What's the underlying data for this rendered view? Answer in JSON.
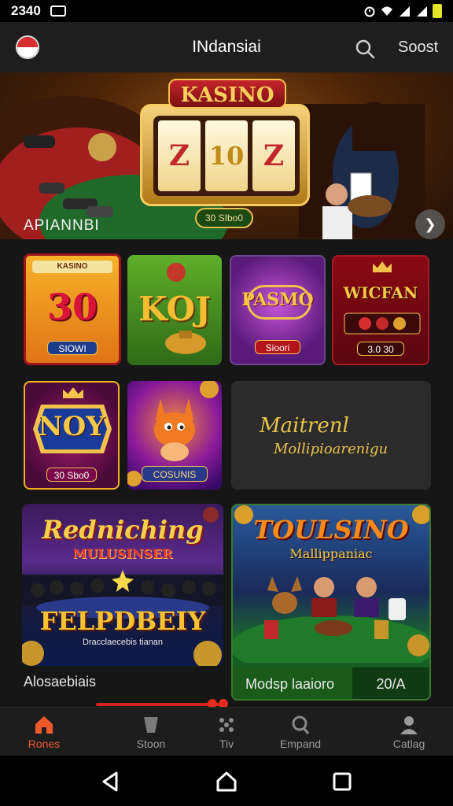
{
  "status": {
    "time": "2340"
  },
  "header": {
    "title": "INdansiai",
    "action_label": "Soost"
  },
  "banner": {
    "title": "KASINO",
    "reels": [
      "Z",
      "10",
      "Z"
    ],
    "button": "30 SIbo0",
    "caption": "APIANNBI"
  },
  "tiles": {
    "t1": {
      "label_top": "KASINO",
      "title": "30",
      "pill": "SIOWI"
    },
    "t2": {
      "title": "KOJ"
    },
    "t3": {
      "title": "PASMO",
      "pill": "Sioori"
    },
    "t4": {
      "title": "WICFAN",
      "pill": "3.0 30"
    },
    "t5": {
      "title": "NOY",
      "pill": "30 Sbo0"
    },
    "t6": {
      "pill": "COSUNIS"
    },
    "t7": {
      "line1": "Maitrenl",
      "line2": "Mollipioarenigu"
    }
  },
  "promos": {
    "left": {
      "headline": "Redniching",
      "sub": "MULUSINSER",
      "big": "FELPDBEIY",
      "caption": "Dracclaecebis tianan",
      "footer": "Alosaebiais"
    },
    "right": {
      "headline": "TOULSINO",
      "sub": "Mallippaniac",
      "footer": "Modsp laaioro",
      "footer_value": "20/A"
    }
  },
  "nav": {
    "home": "Rones",
    "store": "Stoon",
    "tiv": "Tiv",
    "empand": "Empand",
    "catlag": "Catlag"
  },
  "colors": {
    "accent": "#ee5a2a",
    "banner_gold": "#f2c24a"
  }
}
